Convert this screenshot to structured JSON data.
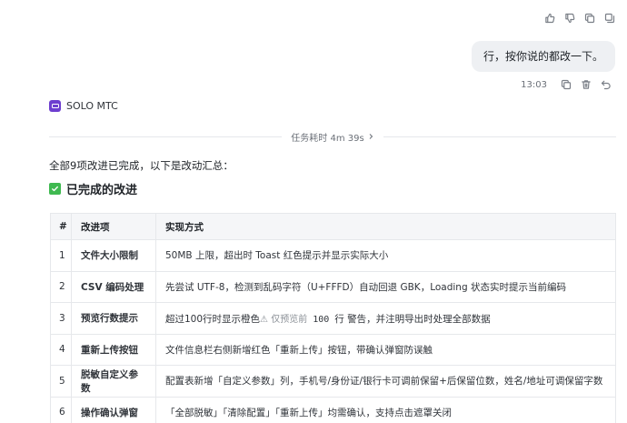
{
  "top_actions": [
    "thumbs-up-icon",
    "thumbs-down-icon",
    "copy-icon",
    "copy-alt-icon"
  ],
  "user_message": {
    "text": "行，按你说的都改一下。",
    "time": "13:03"
  },
  "agent": {
    "name": "SOLO MTC"
  },
  "task": {
    "label": "任务耗时 4m 39s"
  },
  "summary": "全部9项改进已完成，以下是改动汇总：",
  "section_title": "已完成的改进",
  "table": {
    "headers": [
      "#",
      "改进项",
      "实现方式"
    ],
    "rows": [
      {
        "num": "1",
        "item": "文件大小限制",
        "impl": "50MB 上限，超出时 Toast 红色提示并显示实际大小"
      },
      {
        "num": "2",
        "item": "CSV 编码处理",
        "impl": "先尝试 UTF-8，检测到乱码字符（U+FFFD）自动回退 GBK，Loading 状态实时提示当前编码"
      },
      {
        "num": "3",
        "item": "预览行数提示",
        "impl_pre": "超过100行时显示橙色",
        "impl_warn": "⚠ 仅预览前",
        "impl_code": "100",
        "impl_post": "行 警告，并注明导出时处理全部数据"
      },
      {
        "num": "4",
        "item": "重新上传按钮",
        "impl": "文件信息栏右侧新增红色「重新上传」按钮，带确认弹窗防误触"
      },
      {
        "num": "5",
        "item": "脱敏自定义参数",
        "impl": "配置表新增「自定义参数」列，手机号/身份证/银行卡可调前保留+后保留位数，姓名/地址可调保留字数"
      },
      {
        "num": "6",
        "item": "操作确认弹窗",
        "impl": "「全部脱敏」「清除配置」「重新上传」均需确认，支持点击遮罩关闭"
      }
    ]
  }
}
